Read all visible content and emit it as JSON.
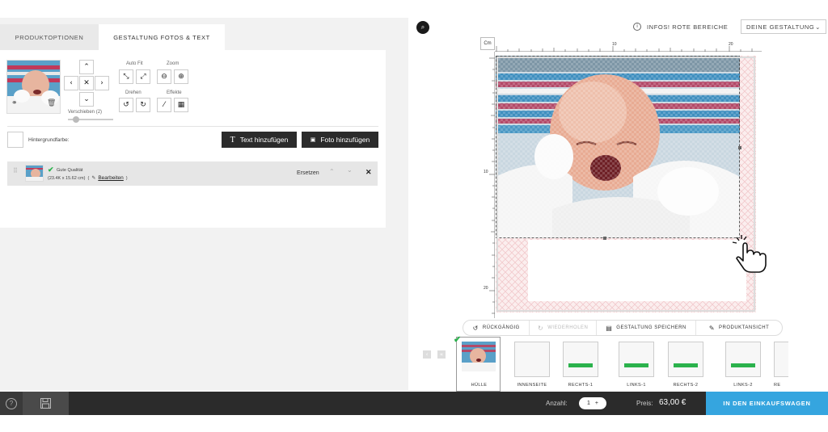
{
  "tabs": {
    "products": "PRODUKTOPTIONEN",
    "design": "GESTALTUNG FOTOS & TEXT"
  },
  "controls": {
    "auto_fit": "Auto Fit",
    "zoom": "Zoom",
    "rotate": "Drehen",
    "effects": "Effekte",
    "shift": "Verschieben (2)",
    "background": "Hintergrundfarbe:"
  },
  "buttons": {
    "add_text": "Text hinzufügen",
    "add_photo": "Foto hinzufügen"
  },
  "photo_item": {
    "quality": "Gute Qualität",
    "size": "(23.4K x 15.62 cm)",
    "edit_prefix": "(",
    "edit": "Bearbeiten",
    "edit_suffix": ")",
    "replace": "Ersetzen"
  },
  "topbar": {
    "info": "INFOS! ROTE BEREICHE",
    "design_select": "DEINE GESTALTUNG"
  },
  "ruler": {
    "unit": "Cm",
    "h_labels": [
      "10",
      "20"
    ],
    "v_labels": [
      "10",
      "20"
    ]
  },
  "actions": {
    "undo": "RÜCKGÄNGIG",
    "redo": "WIEDERHOLEN",
    "save": "GESTALTUNG SPEICHERN",
    "preview": "PRODUKTANSICHT"
  },
  "pages": [
    {
      "label": "HÜLLE"
    },
    {
      "label": "INNENSEITE"
    },
    {
      "label": "RECHTS-1"
    },
    {
      "label": "LINKS-1"
    },
    {
      "label": "RECHTS-2"
    },
    {
      "label": "LINKS-2"
    },
    {
      "label": "RE"
    }
  ],
  "footer": {
    "quantity_label": "Anzahl:",
    "quantity": "1",
    "price_label": "Preis:",
    "price": "63,00 €",
    "cart": "IN DEN EINKAUFSWAGEN"
  },
  "colors": {
    "dark": "#2b2b2b",
    "accent": "#35a5df",
    "check": "#2bb24c"
  }
}
